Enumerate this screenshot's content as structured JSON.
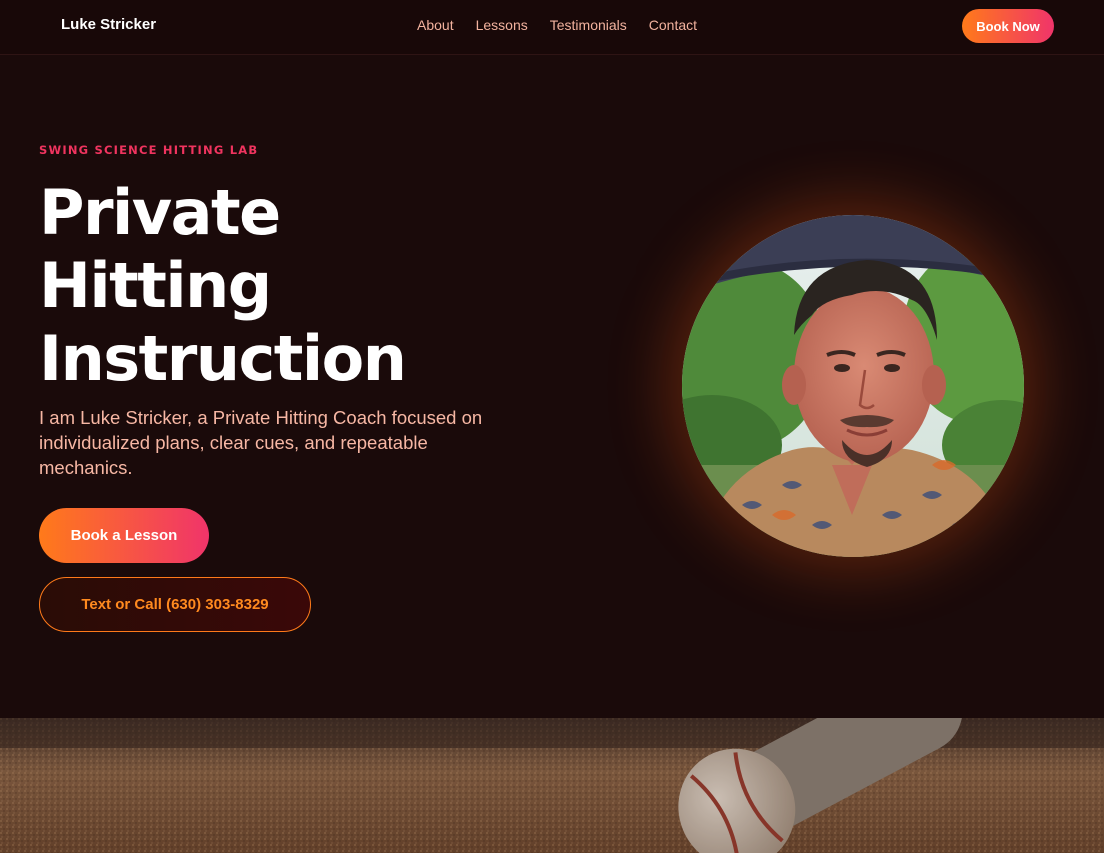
{
  "nav": {
    "brand": "Luke Stricker",
    "links": [
      "About",
      "Lessons",
      "Testimonials",
      "Contact"
    ],
    "cta": "Book Now"
  },
  "hero": {
    "eyebrow": "SWING SCIENCE HITTING LAB",
    "title_lines": [
      "Private",
      "Hitting",
      "Instruction"
    ],
    "lede": "I am Luke Stricker, a Private Hitting Coach focused on individualized plans, clear cues, and repeatable mechanics.",
    "primary_button": "Book a Lesson",
    "secondary_button": "Text or Call (630) 303-8329"
  },
  "colors": {
    "background": "#1a0a0a",
    "accent_orange": "#ff7a1a",
    "accent_pink": "#f0346a",
    "eyebrow": "#f0345f",
    "body_text": "#f7b7a4"
  }
}
